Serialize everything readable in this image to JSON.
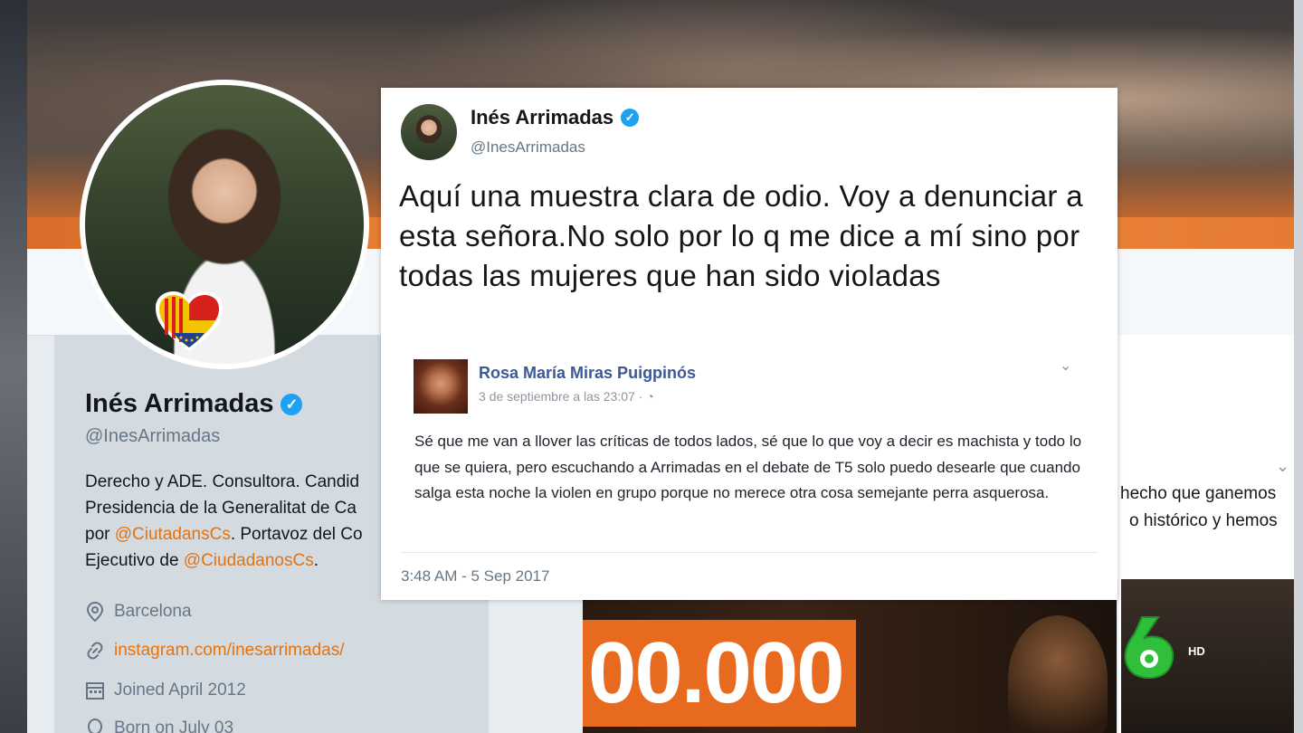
{
  "profile": {
    "name": "Inés Arrimadas",
    "handle": "@InesArrimadas",
    "bio_line1": "Derecho y ADE. Consultora. Candid",
    "bio_line2": "Presidencia de la Generalitat de Ca",
    "bio_line3_prefix": "por ",
    "bio_line3_link": "@CiutadansCs",
    "bio_line3_suffix": ". Portavoz del Co",
    "bio_line4_prefix": "Ejecutivo de ",
    "bio_line4_link": "@CiudadanosCs",
    "bio_line4_suffix": ".",
    "location": "Barcelona",
    "website": "instagram.com/inesarrimadas/",
    "joined": "Joined April 2012",
    "born": "Born on July 03"
  },
  "tweet": {
    "author_name": "Inés Arrimadas",
    "author_handle": "@InesArrimadas",
    "text": "Aquí una muestra clara de odio. Voy a denunciar a esta señora.No solo por lo q me dice a mí sino por todas las mujeres que han sido violadas",
    "timestamp": "3:48 AM - 5 Sep 2017",
    "embedded_post": {
      "author": "Rosa María Miras Puigpinós",
      "date": "3 de septiembre a las 23:07 · ",
      "body": "Sé que me van a llover las críticas de todos lados, sé que lo que voy a decir es machista y todo lo que se quiera, pero escuchando a Arrimadas en el debate de T5 solo puedo desearle que cuando salga esta noche la violen en grupo porque no merece otra cosa semejante perra asquerosa."
    }
  },
  "background_tweet": {
    "line1": "hecho que ganemos",
    "line2": "o histórico y hemos"
  },
  "media": {
    "counter": "00.000",
    "channel_badge": "HD"
  },
  "colors": {
    "link": "#e4720f",
    "verified": "#1da1f2",
    "facebook_name": "#3b5998"
  }
}
